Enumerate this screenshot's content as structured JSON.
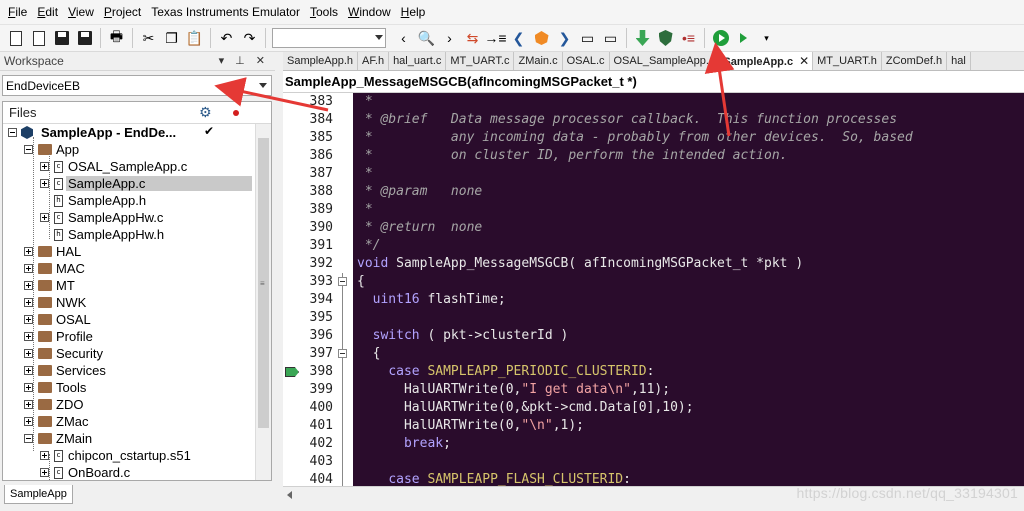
{
  "menu": [
    {
      "label": "File",
      "acc": "F",
      "rest": "ile"
    },
    {
      "label": "Edit",
      "acc": "E",
      "rest": "dit"
    },
    {
      "label": "View",
      "acc": "V",
      "rest": "iew"
    },
    {
      "label": "Project",
      "acc": "P",
      "rest": "roject"
    },
    {
      "label": "Texas Instruments Emulator",
      "acc": "",
      "rest": "Texas Instruments Emulator"
    },
    {
      "label": "Tools",
      "acc": "T",
      "rest": "ools"
    },
    {
      "label": "Window",
      "acc": "W",
      "rest": "indow"
    },
    {
      "label": "Help",
      "acc": "H",
      "rest": "elp"
    }
  ],
  "workspace": {
    "title": "Workspace",
    "controls": "▾ ⊥ ✕",
    "config": "EndDeviceEB",
    "files_header": "Files",
    "bottom_tab": "SampleApp",
    "tree": [
      {
        "label": "SampleApp - EndDe...",
        "kind": "project"
      },
      {
        "label": "App",
        "kind": "folder"
      },
      {
        "label": "OSAL_SampleApp.c",
        "kind": "file-c"
      },
      {
        "label": "SampleApp.c",
        "kind": "file-c"
      },
      {
        "label": "SampleApp.h",
        "kind": "file-h"
      },
      {
        "label": "SampleAppHw.c",
        "kind": "file-c"
      },
      {
        "label": "SampleAppHw.h",
        "kind": "file-h"
      },
      {
        "label": "HAL",
        "kind": "folder"
      },
      {
        "label": "MAC",
        "kind": "folder"
      },
      {
        "label": "MT",
        "kind": "folder"
      },
      {
        "label": "NWK",
        "kind": "folder"
      },
      {
        "label": "OSAL",
        "kind": "folder"
      },
      {
        "label": "Profile",
        "kind": "folder"
      },
      {
        "label": "Security",
        "kind": "folder"
      },
      {
        "label": "Services",
        "kind": "folder"
      },
      {
        "label": "Tools",
        "kind": "folder"
      },
      {
        "label": "ZDO",
        "kind": "folder"
      },
      {
        "label": "ZMac",
        "kind": "folder"
      },
      {
        "label": "ZMain",
        "kind": "folder"
      },
      {
        "label": "chipcon_cstartup.s51",
        "kind": "file-c"
      },
      {
        "label": "OnBoard.c",
        "kind": "file-c"
      }
    ]
  },
  "editor": {
    "tabs": [
      "SampleApp.h",
      "AF.h",
      "hal_uart.c",
      "MT_UART.c",
      "ZMain.c",
      "OSAL.c",
      "OSAL_SampleApp.c",
      "SampleApp.c",
      "MT_UART.h",
      "ZComDef.h",
      "hal"
    ],
    "active_tab": "SampleApp.c",
    "function": "SampleApp_MessageMSGCB(afIncomingMSGPacket_t *)",
    "line_numbers": [
      "383",
      "384",
      "385",
      "386",
      "387",
      "388",
      "389",
      "390",
      "391",
      "392",
      "393",
      "394",
      "395",
      "396",
      "397",
      "398",
      "399",
      "400",
      "401",
      "402",
      "403",
      "404"
    ],
    "code_lines": [
      " *",
      " * @brief   Data message processor callback.  This function processes",
      " *          any incoming data - probably from other devices.  So, based",
      " *          on cluster ID, perform the intended action.",
      " *",
      " * @param   none",
      " *",
      " * @return  none",
      " */",
      "void SampleApp_MessageMSGCB( afIncomingMSGPacket_t *pkt )",
      "{",
      "  uint16 flashTime;",
      "",
      "  switch ( pkt->clusterId )",
      "  {",
      "    case SAMPLEAPP_PERIODIC_CLUSTERID:",
      "      HalUARTWrite(0,\"I get data\\n\",11);",
      "      HalUARTWrite(0,&pkt->cmd.Data[0],10);",
      "      HalUARTWrite(0,\"\\n\",1);",
      "      break;",
      "",
      "    case SAMPLEAPP_FLASH_CLUSTERID:"
    ]
  },
  "watermark": "https://blog.csdn.net/qq_33194301",
  "colors": {
    "code_bg": "#2a0c2c",
    "comment": "#a6a6a6",
    "keyword": "#b2a3ff",
    "arrow": "#e53935"
  }
}
